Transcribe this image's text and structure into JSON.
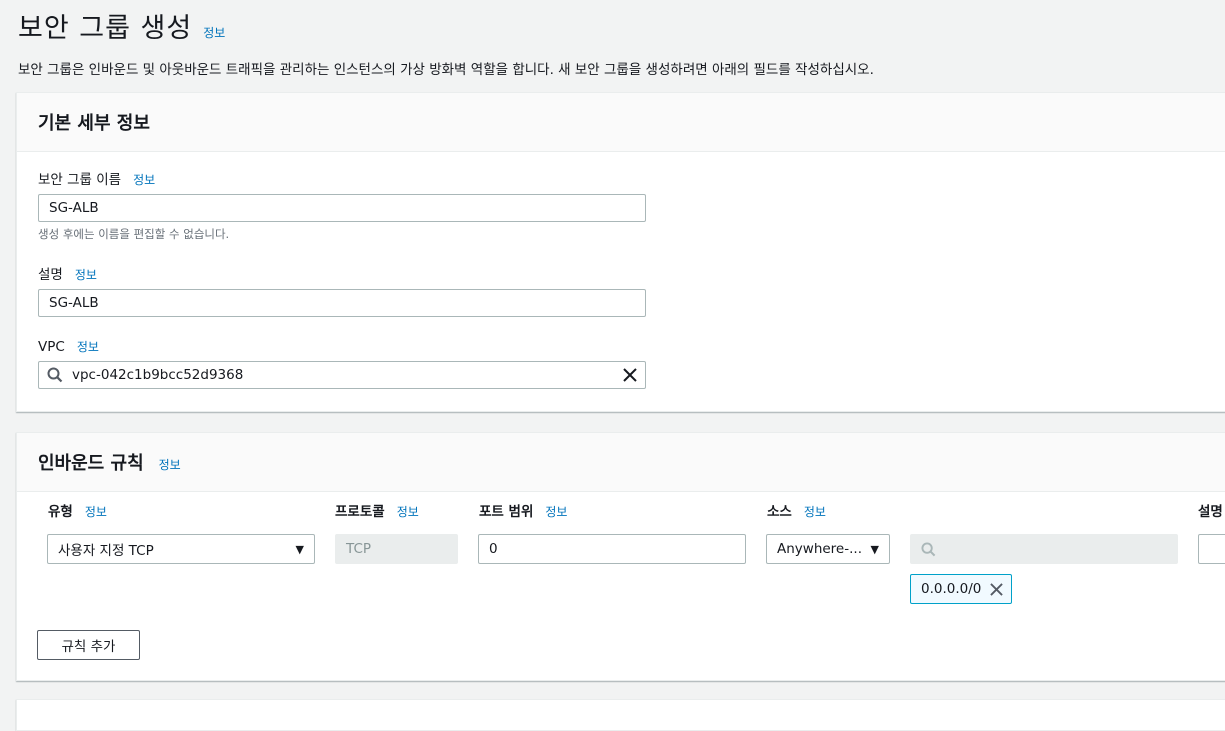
{
  "page": {
    "title": "보안 그룹 생성",
    "info": "정보",
    "description": "보안 그룹은 인바운드 및 아웃바운드 트래픽을 관리하는 인스턴스의 가상 방화벽 역할을 합니다. 새 보안 그룹을 생성하려면 아래의 필드를 작성하십시오."
  },
  "basic": {
    "title": "기본 세부 정보",
    "name_label": "보안 그룹 이름",
    "name_value": "SG-ALB",
    "name_hint": "생성 후에는 이름을 편집할 수 없습니다.",
    "desc_label": "설명",
    "desc_value": "SG-ALB",
    "vpc_label": "VPC",
    "vpc_value": "vpc-042c1b9bcc52d9368",
    "info": "정보"
  },
  "inbound": {
    "title": "인바운드 규칙",
    "info": "정보",
    "columns": {
      "type": "유형",
      "protocol": "프로토콜",
      "port": "포트 범위",
      "source": "소스",
      "desc": "설명"
    },
    "rule": {
      "type": "사용자 지정 TCP",
      "protocol": "TCP",
      "port": "0",
      "source": "Anywhere-...",
      "source_search": "",
      "cidr": "0.0.0.0/0"
    },
    "add_rule": "규칙 추가"
  },
  "icons": {
    "search": "search-icon",
    "clear": "close-icon",
    "dropdown": "caret-down-icon",
    "remove": "close-icon"
  },
  "colors": {
    "link": "#0073bb",
    "token_border": "#00a1c9",
    "background": "#f2f3f3"
  }
}
